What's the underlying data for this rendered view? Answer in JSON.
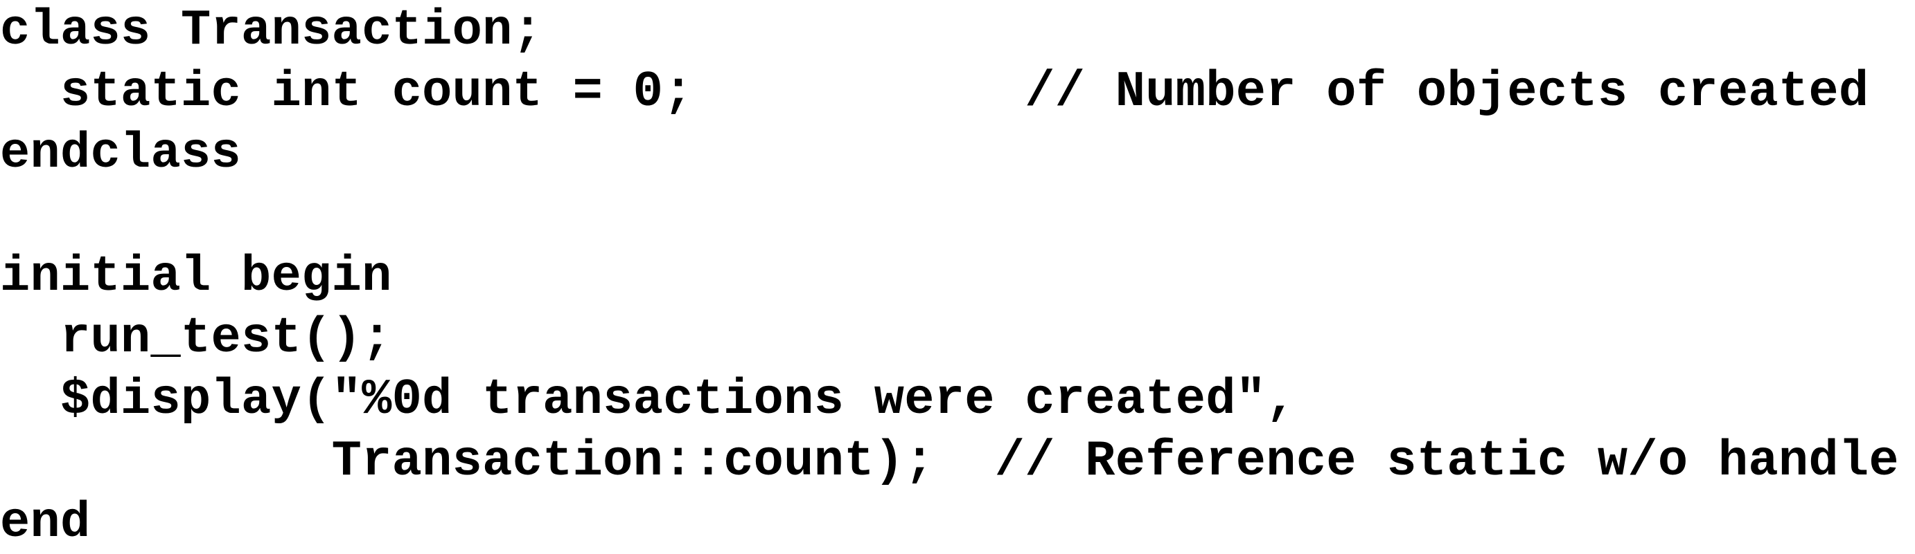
{
  "code": {
    "lines": [
      "class Transaction;",
      "  static int count = 0;           // Number of objects created",
      "endclass",
      "",
      "initial begin",
      "  run_test();",
      "  $display(\"%0d transactions were created\",",
      "           Transaction::count);  // Reference static w/o handle",
      "end"
    ]
  }
}
